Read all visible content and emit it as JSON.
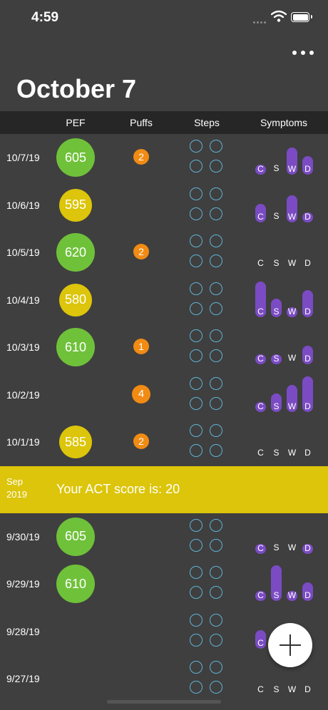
{
  "status_bar": {
    "time": "4:59"
  },
  "header": {
    "title": "October 7"
  },
  "columns": {
    "pef": "PEF",
    "puffs": "Puffs",
    "steps": "Steps",
    "symptoms": "Symptoms"
  },
  "symptom_letters": [
    "C",
    "S",
    "W",
    "D"
  ],
  "colors": {
    "pef_green": "#6fc13a",
    "pef_yellow": "#dcc50a",
    "puff_orange": "#f18b13",
    "symptom_purple": "#7b4bc4",
    "steps_blue": "#5fb3d6"
  },
  "banner": {
    "month": "Sep",
    "year": "2019",
    "message": "Your ACT score is: 20"
  },
  "rows_october": [
    {
      "date": "10/7/19",
      "pef": "605",
      "pef_color": "green",
      "puffs": "2",
      "symptoms": [
        1,
        0,
        3,
        2
      ]
    },
    {
      "date": "10/6/19",
      "pef": "595",
      "pef_color": "yellow",
      "puffs": "",
      "symptoms": [
        2,
        0,
        3,
        1
      ]
    },
    {
      "date": "10/5/19",
      "pef": "620",
      "pef_color": "green",
      "puffs": "2",
      "symptoms": [
        0,
        0,
        0,
        0
      ]
    },
    {
      "date": "10/4/19",
      "pef": "580",
      "pef_color": "yellow",
      "puffs": "",
      "symptoms": [
        4,
        2,
        1,
        3
      ]
    },
    {
      "date": "10/3/19",
      "pef": "610",
      "pef_color": "green",
      "puffs": "1",
      "symptoms": [
        1,
        1,
        0,
        2
      ]
    },
    {
      "date": "10/2/19",
      "pef": "",
      "pef_color": "",
      "puffs": "4",
      "symptoms": [
        1,
        2,
        3,
        4
      ]
    },
    {
      "date": "10/1/19",
      "pef": "585",
      "pef_color": "yellow",
      "puffs": "2",
      "symptoms": [
        0,
        0,
        0,
        0
      ]
    }
  ],
  "rows_september": [
    {
      "date": "9/30/19",
      "pef": "605",
      "pef_color": "green",
      "puffs": "",
      "symptoms": [
        1,
        0,
        0,
        1
      ]
    },
    {
      "date": "9/29/19",
      "pef": "610",
      "pef_color": "green",
      "puffs": "",
      "symptoms": [
        1,
        4,
        1,
        2
      ]
    },
    {
      "date": "9/28/19",
      "pef": "",
      "pef_color": "",
      "puffs": "",
      "symptoms": [
        2,
        0,
        0,
        0
      ]
    },
    {
      "date": "9/27/19",
      "pef": "",
      "pef_color": "",
      "puffs": "",
      "symptoms": [
        0,
        0,
        0,
        0
      ]
    }
  ]
}
